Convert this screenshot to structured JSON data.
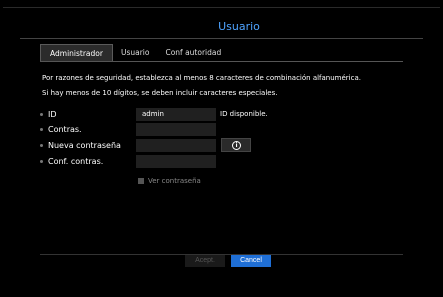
{
  "title": "Usuario",
  "tabs": [
    {
      "label": "Administrador",
      "active": true
    },
    {
      "label": "Usuario",
      "active": false
    },
    {
      "label": "Conf autoridad",
      "active": false
    }
  ],
  "info": {
    "line1": "Por razones de seguridad, establezca al menos 8 caracteres de combinación alfanumérica.",
    "line2": "Si hay menos de 10 dígitos, se deben incluir caracteres especiales."
  },
  "form": {
    "id_label": "ID",
    "id_value": "admin",
    "id_status": "ID disponible.",
    "password_label": "Contras.",
    "new_password_label": "Nueva contraseña",
    "info_icon": "info-icon",
    "confirm_password_label": "Conf. contras.",
    "show_password_label": "Ver contraseña"
  },
  "buttons": {
    "accept": "Acept.",
    "cancel": "Cancel"
  },
  "colors": {
    "accent": "#4ea3ff",
    "cancel_button": "#1f6fd6"
  }
}
